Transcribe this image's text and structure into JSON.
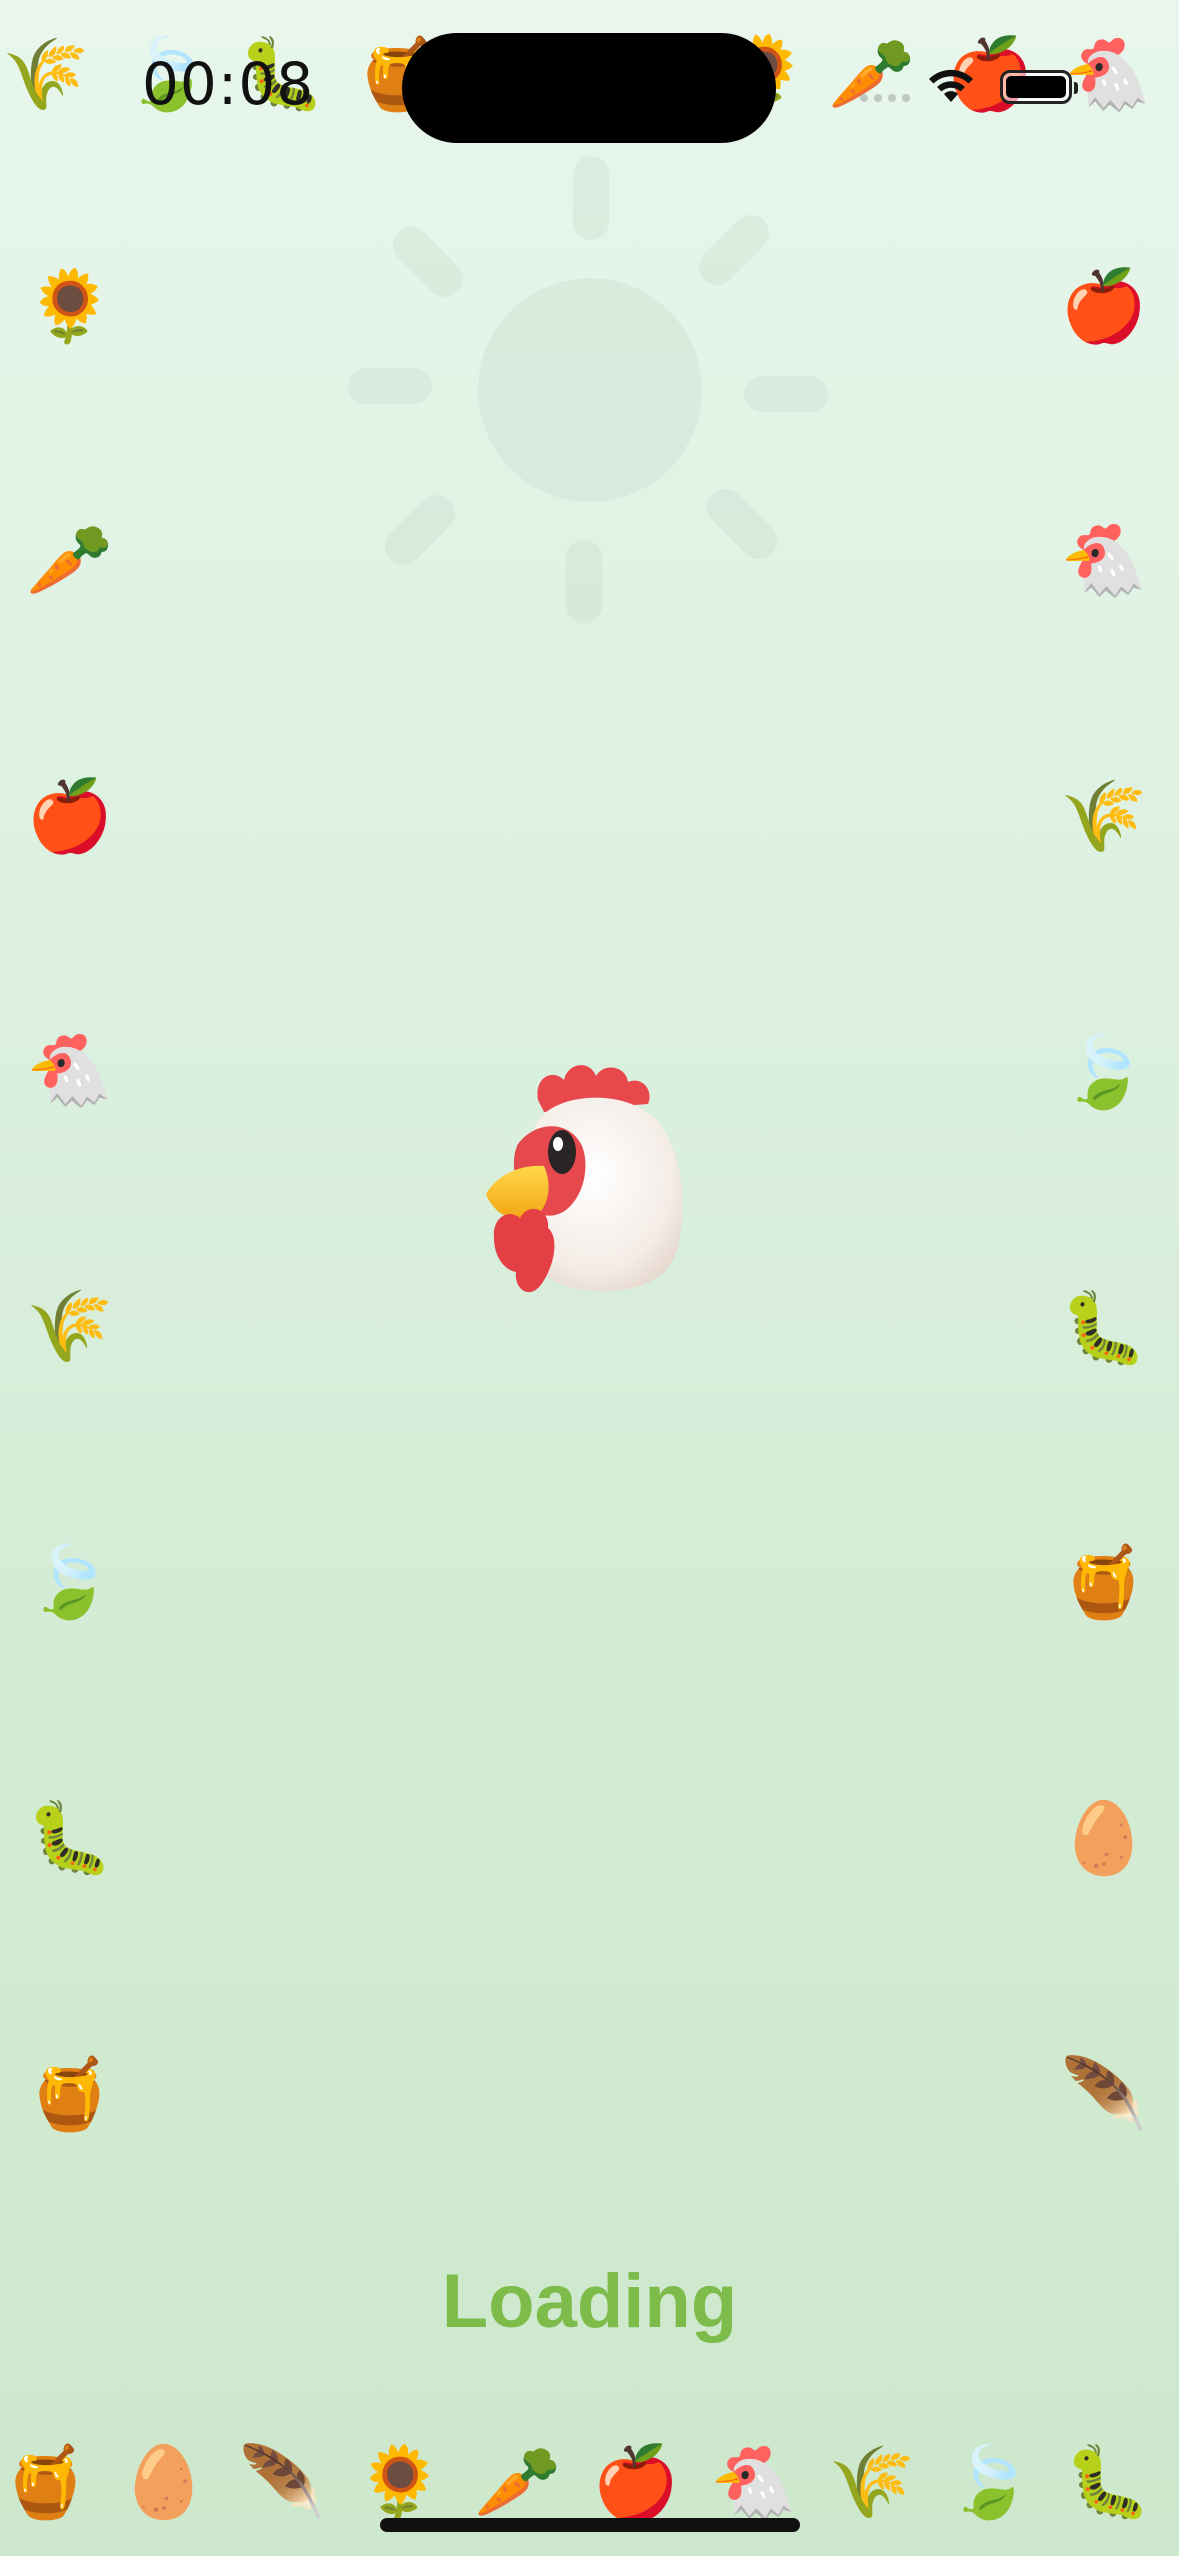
{
  "status_bar": {
    "time": "00:08"
  },
  "loading": {
    "label": "Loading"
  },
  "colors": {
    "accent": "#7dbb4a",
    "background_top": "#e8f6ec",
    "background_bottom": "#cde8cc"
  },
  "icons": {
    "rice": "🌾",
    "leaf": "🍃",
    "caterpillar": "🐛",
    "honey": "🍯",
    "sunflower": "🌻",
    "carrot": "🥕",
    "apple": "🍎",
    "chicken": "🐔",
    "egg": "🥚",
    "feather": "🪶"
  }
}
